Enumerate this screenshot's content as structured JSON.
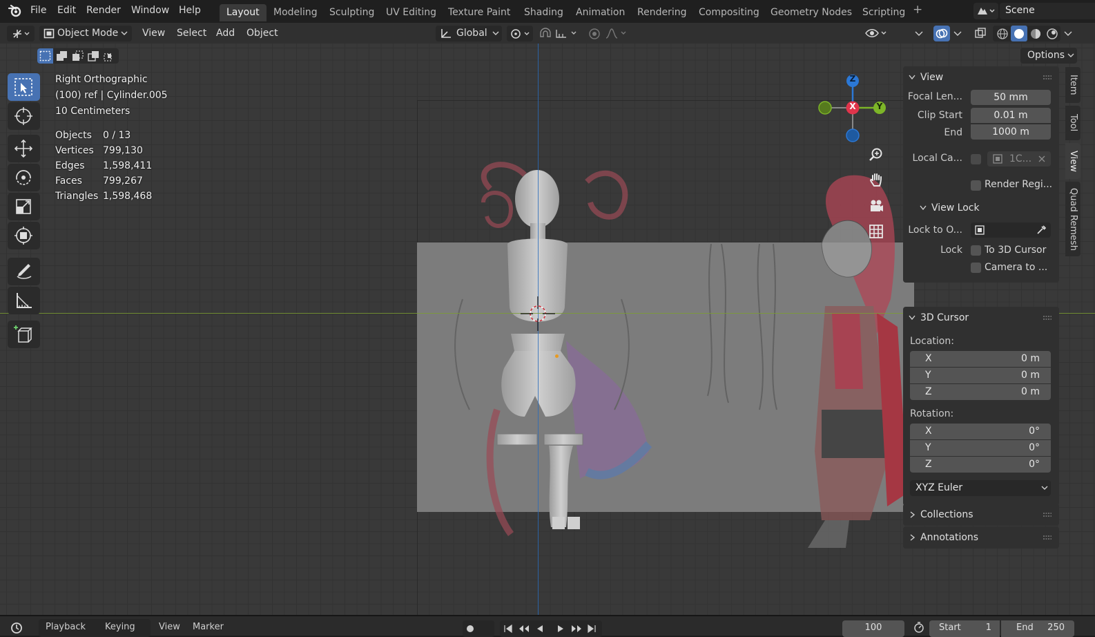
{
  "topbar": {
    "menu": [
      "File",
      "Edit",
      "Render",
      "Window",
      "Help"
    ],
    "workspaces": [
      "Layout",
      "Modeling",
      "Sculpting",
      "UV Editing",
      "Texture Paint",
      "Shading",
      "Animation",
      "Rendering",
      "Compositing",
      "Geometry Nodes",
      "Scripting"
    ],
    "active_workspace": "Layout",
    "add_tab": "+",
    "scene": "Scene"
  },
  "header": {
    "mode": "Object Mode",
    "menus": [
      "View",
      "Select",
      "Add",
      "Object"
    ],
    "transform_orientation": "Global",
    "options": "Options"
  },
  "viewport": {
    "view_name": "Right Orthographic",
    "collection_info": "(100) ref | Cylinder.005",
    "scale": "10 Centimeters",
    "stats": [
      {
        "label": "Objects",
        "value": "0 / 13"
      },
      {
        "label": "Vertices",
        "value": "799,130"
      },
      {
        "label": "Edges",
        "value": "1,598,411"
      },
      {
        "label": "Faces",
        "value": "799,267"
      },
      {
        "label": "Triangles",
        "value": "1,598,468"
      }
    ],
    "gizmo": {
      "z": "Z",
      "x": "X",
      "y": "Y"
    }
  },
  "npanel": {
    "view_section": "View",
    "focal_length_label": "Focal Len...",
    "focal_length": "50 mm",
    "clip_start_label": "Clip Start",
    "clip_start": "0.01 m",
    "clip_end_label": "End",
    "clip_end": "1000 m",
    "local_camera_label": "Local Ca...",
    "local_camera_value": "1C...",
    "render_region": "Render Regi...",
    "view_lock_section": "View Lock",
    "lock_to_object_label": "Lock to O...",
    "lock_label": "Lock",
    "to_3d_cursor": "To 3D Cursor",
    "camera_to": "Camera to ...",
    "cursor_section": "3D Cursor",
    "location_label": "Location:",
    "location": [
      {
        "axis": "X",
        "value": "0 m"
      },
      {
        "axis": "Y",
        "value": "0 m"
      },
      {
        "axis": "Z",
        "value": "0 m"
      }
    ],
    "rotation_label": "Rotation:",
    "rotation": [
      {
        "axis": "X",
        "value": "0°"
      },
      {
        "axis": "Y",
        "value": "0°"
      },
      {
        "axis": "Z",
        "value": "0°"
      }
    ],
    "rotation_mode": "XYZ Euler",
    "collections_section": "Collections",
    "annotations_section": "Annotations"
  },
  "side_tabs": [
    "Item",
    "Tool",
    "View",
    "Quad Remesh"
  ],
  "active_side_tab": "View",
  "timeline": {
    "menus": [
      "Playback",
      "Keying",
      "View",
      "Marker"
    ],
    "current_frame": "100",
    "start_label": "Start",
    "start": "1",
    "end_label": "End",
    "end": "250"
  },
  "colors": {
    "accent": "#4772b3",
    "x_axis": "#e0344b",
    "y_axis": "#7db528",
    "z_axis": "#2b78d6"
  }
}
